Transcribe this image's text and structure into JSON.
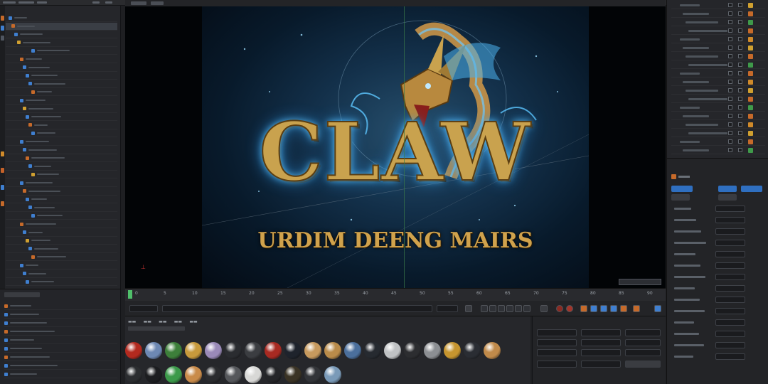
{
  "viewport": {
    "title": "CLAW",
    "subtitle": "URDIM DEENG MAIRS"
  },
  "timeline": {
    "ticks": [
      "0",
      "5",
      "10",
      "15",
      "20",
      "25",
      "30",
      "35",
      "40",
      "45",
      "50",
      "55",
      "60",
      "65",
      "70",
      "75",
      "80",
      "85",
      "90"
    ]
  },
  "colors": {
    "accent": "#3f7fd0",
    "selection": "#2f6fc0",
    "gold": "#c9a24e",
    "glow": "#5ec7ff",
    "playhead": "#4fbf6a"
  },
  "materials": [
    "#b32a1f",
    "#6d88b3",
    "#3d7f3a",
    "#c89a3c",
    "#9a8ab8",
    "#2a2c30",
    "#3b3d41",
    "#a82a22",
    "#1e232c",
    "#c79a5e",
    "#b98b4a",
    "#4b6f9c",
    "#262a30",
    "#c0c2c4",
    "#2c2d30",
    "#8c8f93",
    "#c6952f",
    "#2a2d33",
    "#c08a4a",
    "#2b2d30",
    "#1c1d20",
    "#3c9a4a",
    "#c98b4a",
    "#2a2b2e",
    "#55575b",
    "#d8d8d6",
    "#242528",
    "#3a3325",
    "#323438",
    "#7a9ab8"
  ],
  "icons": [
    "render-icon",
    "gear-icon",
    "camera-icon",
    "light-icon",
    "play-icon",
    "stop-icon",
    "record-icon",
    "key-icon"
  ]
}
